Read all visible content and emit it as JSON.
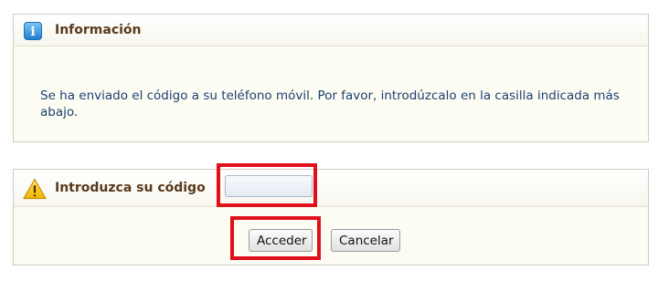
{
  "info_panel": {
    "icon": "info-icon",
    "title": "Información",
    "message": "Se ha enviado el código a su teléfono móvil. Por favor, introdúzcalo en la casilla indicada más abajo."
  },
  "code_panel": {
    "icon": "warning-icon",
    "title": "Introduzca su código",
    "code_value": "",
    "submit_label": "Acceder",
    "cancel_label": "Cancelar"
  },
  "colors": {
    "title": "#5a3a1c",
    "message": "#1c3f72",
    "panel_bg": "#fdfcf3",
    "highlight": "#e0101b"
  }
}
